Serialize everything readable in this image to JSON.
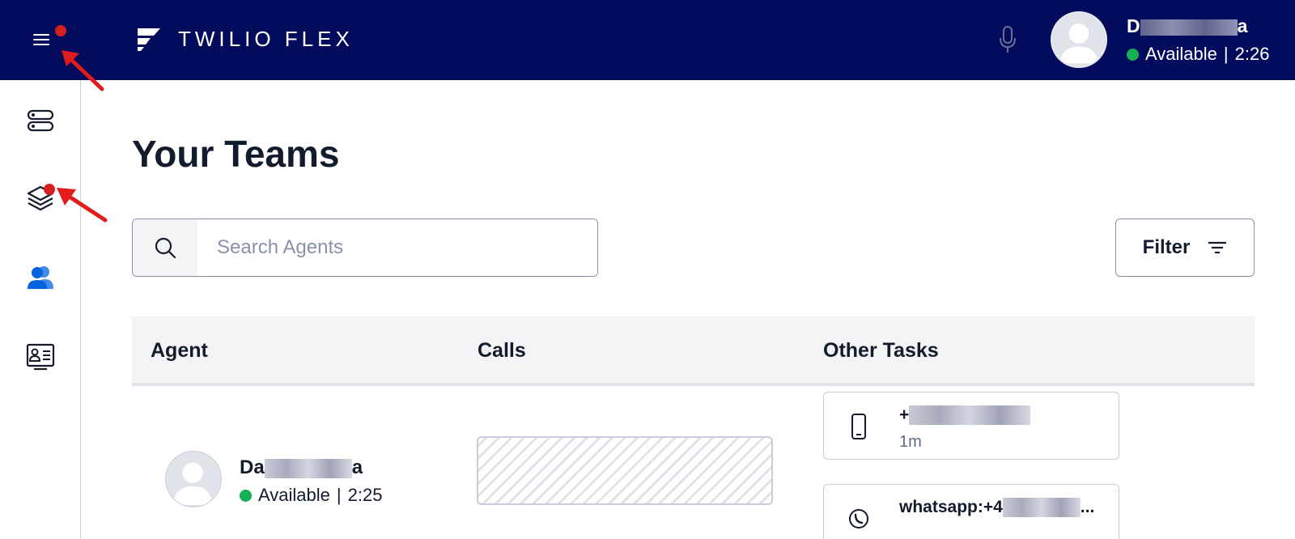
{
  "header": {
    "brand": "TWILIO FLEX",
    "user": {
      "name_start": "D",
      "name_end": "a",
      "status": "Available",
      "timer": "2:26"
    }
  },
  "sidebar": {
    "items": [
      {
        "icon": "queues-icon"
      },
      {
        "icon": "layers-icon"
      },
      {
        "icon": "teams-icon"
      },
      {
        "icon": "agent-card-icon"
      }
    ]
  },
  "page": {
    "title": "Your Teams"
  },
  "search": {
    "placeholder": "Search Agents"
  },
  "filter": {
    "label": "Filter"
  },
  "table": {
    "headers": [
      "Agent",
      "Calls",
      "Other Tasks"
    ],
    "rows": [
      {
        "agent": {
          "name_start": "Da",
          "name_end": "a",
          "status": "Available",
          "timer": "2:25"
        },
        "tasks": [
          {
            "channel": "phone-icon",
            "title_start": "+",
            "duration": "1m"
          },
          {
            "channel": "whatsapp-icon",
            "title_start": "whatsapp:+4",
            "title_end": "..."
          }
        ]
      }
    ]
  },
  "colors": {
    "topbar": "#030b5d",
    "available": "#14b053",
    "annotation": "#d61f1f",
    "accent_blue": "#0263e0"
  }
}
